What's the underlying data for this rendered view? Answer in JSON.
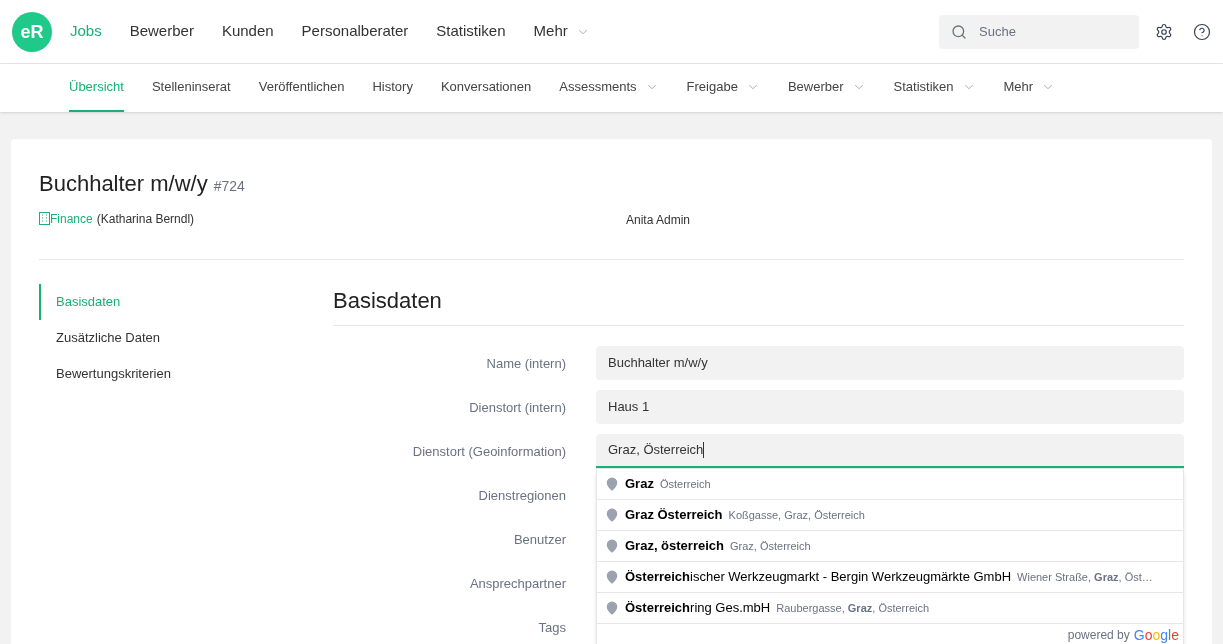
{
  "logo": {
    "text": "eR"
  },
  "main_nav": [
    {
      "label": "Jobs",
      "selected": true,
      "dropdown": false
    },
    {
      "label": "Bewerber",
      "selected": false,
      "dropdown": false
    },
    {
      "label": "Kunden",
      "selected": false,
      "dropdown": false
    },
    {
      "label": "Personalberater",
      "selected": false,
      "dropdown": false
    },
    {
      "label": "Statistiken",
      "selected": false,
      "dropdown": false
    },
    {
      "label": "Mehr",
      "selected": false,
      "dropdown": true
    }
  ],
  "search": {
    "placeholder": "Suche"
  },
  "sub_nav": [
    {
      "label": "Übersicht",
      "selected": true,
      "dropdown": false
    },
    {
      "label": "Stelleninserat",
      "selected": false,
      "dropdown": false
    },
    {
      "label": "Veröffentlichen",
      "selected": false,
      "dropdown": false
    },
    {
      "label": "History",
      "selected": false,
      "dropdown": false
    },
    {
      "label": "Konversationen",
      "selected": false,
      "dropdown": false
    },
    {
      "label": "Assessments",
      "selected": false,
      "dropdown": true
    },
    {
      "label": "Freigabe",
      "selected": false,
      "dropdown": true
    },
    {
      "label": "Bewerber",
      "selected": false,
      "dropdown": true
    },
    {
      "label": "Statistiken",
      "selected": false,
      "dropdown": true
    },
    {
      "label": "Mehr",
      "selected": false,
      "dropdown": true
    }
  ],
  "job": {
    "title": "Buchhalter m/w/y",
    "number": "#724",
    "department": "Finance",
    "contact": "(Katharina Berndl)",
    "owner": "Anita Admin"
  },
  "side_menu": [
    {
      "label": "Basisdaten",
      "selected": true
    },
    {
      "label": "Zusätzliche Daten",
      "selected": false
    },
    {
      "label": "Bewertungskriterien",
      "selected": false
    }
  ],
  "section_title": "Basisdaten",
  "form_rows": [
    {
      "label": "Name (intern)",
      "value": "Buchhalter m/w/y",
      "kind": "field",
      "focused": false
    },
    {
      "label": "Dienstort (intern)",
      "value": "Haus 1",
      "kind": "field",
      "focused": false
    },
    {
      "label": "Dienstort (Geoinformation)",
      "value": "Graz, Österreich",
      "kind": "field",
      "focused": true
    },
    {
      "label": "Dienstregionen",
      "kind": "hidden"
    },
    {
      "label": "Benutzer",
      "kind": "hidden"
    },
    {
      "label": "Ansprechpartner",
      "kind": "hidden"
    },
    {
      "label": "Tags",
      "kind": "hidden"
    }
  ],
  "suggestions": [
    {
      "main": "**Graz**",
      "secondary": "Österreich"
    },
    {
      "main": "**Graz Österreich**",
      "secondary": "Koßgasse, Graz, Österreich"
    },
    {
      "main": "**Graz, österreich**",
      "secondary": "Graz, Österreich"
    },
    {
      "main": "**Österreich**ischer Werkzeugmarkt - Bergin Werkzeugmärkte GmbH",
      "secondary": "Wiener Straße, **Graz**, Öst…"
    },
    {
      "main": "**Österreich**ring Ges.mbH",
      "secondary": "Raubergasse, **Graz**, Österreich"
    }
  ],
  "attribution": {
    "text": "powered by",
    "brand": "Google"
  }
}
